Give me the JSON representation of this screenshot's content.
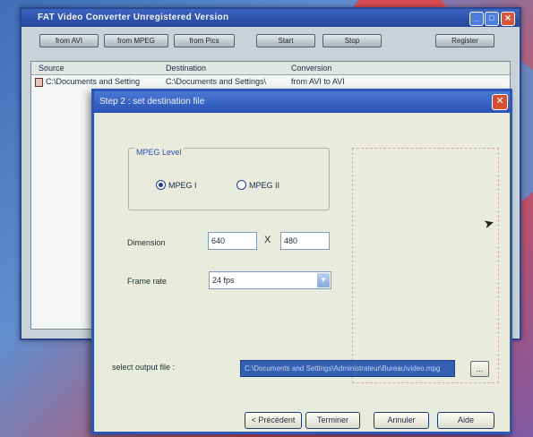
{
  "main_window": {
    "title": "FAT Video Converter Unregistered Version",
    "toolbar": {
      "from_avi": "from AVI",
      "from_mpeg": "from MPEG",
      "from_pics": "from Pics",
      "start": "Start",
      "stop": "Stop",
      "register": "Register"
    },
    "columns": [
      "Source",
      "Destination",
      "Conversion"
    ],
    "rows": [
      {
        "source": "C:\\Documents and Setting",
        "destination": "C:\\Documents and Settings\\",
        "conversion": "from AVI to AVI"
      }
    ]
  },
  "dialog": {
    "title": "Step 2 : set destination file",
    "mpeg_group": {
      "legend": "MPEG Level",
      "option1": "MPEG I",
      "option2": "MPEG II",
      "selected": "MPEG I"
    },
    "dimension": {
      "label": "Dimension",
      "width": "640",
      "height": "480",
      "separator": "X"
    },
    "frame_rate": {
      "label": "Frame rate",
      "value": "24 fps"
    },
    "output": {
      "label": "select output file :",
      "path": "C:\\Documents and Settings\\Administrateur\\Bureau\\video.mpg",
      "browse": "..."
    },
    "buttons": {
      "previous": "< Précédent",
      "finish": "Terminer",
      "cancel": "Annuler",
      "help": "Aide"
    }
  }
}
